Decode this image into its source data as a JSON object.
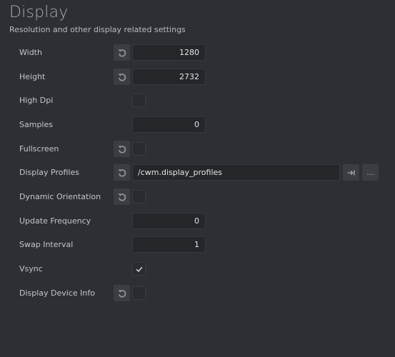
{
  "header": {
    "title": "Display",
    "subtitle": "Resolution and other display related settings"
  },
  "settings": [
    {
      "label": "Width",
      "type": "number",
      "value": "1280",
      "resettable": true
    },
    {
      "label": "Height",
      "type": "number",
      "value": "2732",
      "resettable": true
    },
    {
      "label": "High Dpi",
      "type": "checkbox",
      "checked": false,
      "resettable": false
    },
    {
      "label": "Samples",
      "type": "number",
      "value": "0",
      "resettable": false
    },
    {
      "label": "Fullscreen",
      "type": "checkbox",
      "checked": false,
      "resettable": true
    },
    {
      "label": "Display Profiles",
      "type": "resource",
      "value": "/cwm.display_profiles",
      "resettable": true,
      "open_icon": "goto-resource-icon",
      "browse_label": "..."
    },
    {
      "label": "Dynamic Orientation",
      "type": "checkbox",
      "checked": false,
      "resettable": true
    },
    {
      "label": "Update Frequency",
      "type": "number",
      "value": "0",
      "resettable": false
    },
    {
      "label": "Swap Interval",
      "type": "number",
      "value": "1",
      "resettable": false
    },
    {
      "label": "Vsync",
      "type": "checkbox",
      "checked": true,
      "resettable": false
    },
    {
      "label": "Display Device Info",
      "type": "checkbox",
      "checked": false,
      "resettable": true
    }
  ],
  "icons": {
    "reset": "reset-icon",
    "check": "checkmark-icon"
  }
}
